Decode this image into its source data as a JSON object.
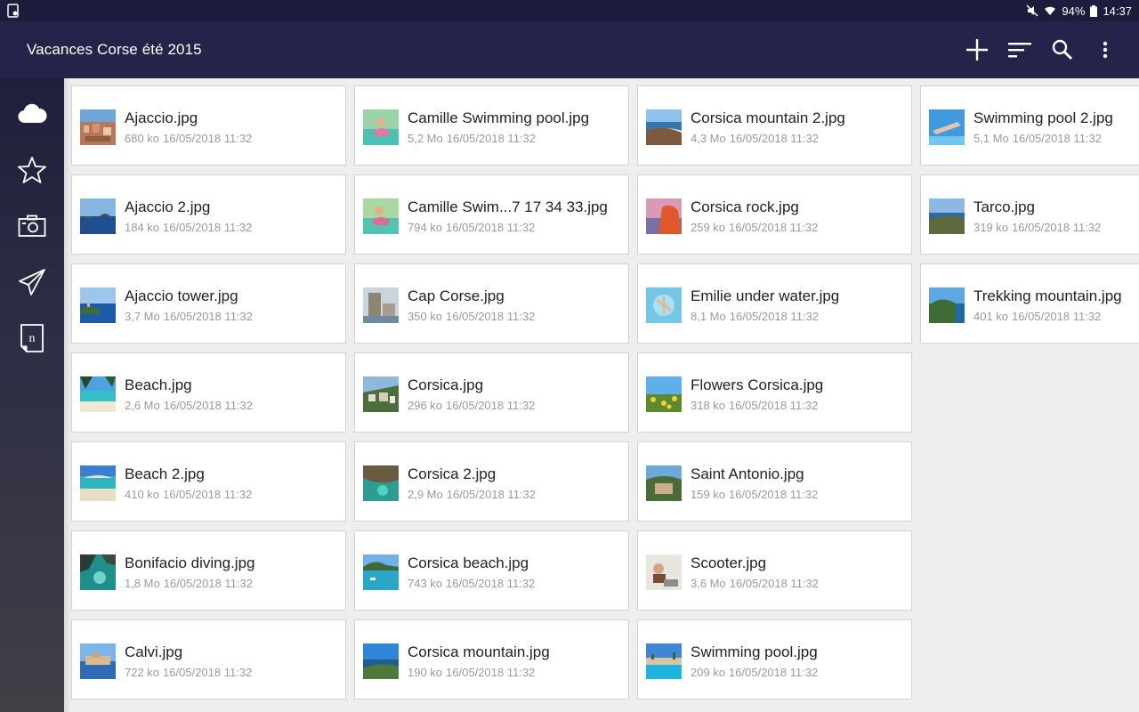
{
  "status_bar": {
    "battery": "94%",
    "time": "14:37"
  },
  "header": {
    "title": "Vacances Corse été 2015",
    "colors": {
      "app_bar": "#24244a",
      "status_bar": "#1c1c3c"
    }
  },
  "rail": {
    "items": [
      {
        "icon": "cloud-icon"
      },
      {
        "icon": "star-icon"
      },
      {
        "icon": "camera-icon"
      },
      {
        "icon": "paper-plane-icon"
      },
      {
        "icon": "note-icon",
        "glyph": "n"
      }
    ]
  },
  "files": [
    {
      "name": "Ajaccio.jpg",
      "size": "680 ko",
      "date": "16/05/2018 11:32"
    },
    {
      "name": "Ajaccio 2.jpg",
      "size": "184 ko",
      "date": "16/05/2018 11:32"
    },
    {
      "name": "Ajaccio tower.jpg",
      "size": "3,7 Mo",
      "date": "16/05/2018 11:32"
    },
    {
      "name": "Beach.jpg",
      "size": "2,6 Mo",
      "date": "16/05/2018 11:32"
    },
    {
      "name": "Beach 2.jpg",
      "size": "410 ko",
      "date": "16/05/2018 11:32"
    },
    {
      "name": "Bonifacio diving.jpg",
      "size": "1,8 Mo",
      "date": "16/05/2018 11:32"
    },
    {
      "name": "Calvi.jpg",
      "size": "722 ko",
      "date": "16/05/2018 11:32"
    },
    {
      "name": "Camille Swimming pool.jpg",
      "size": "5,2 Mo",
      "date": "16/05/2018 11:32"
    },
    {
      "name": "Camille Swim...7 17 34 33.jpg",
      "size": "794 ko",
      "date": "16/05/2018 11:32"
    },
    {
      "name": "Cap Corse.jpg",
      "size": "350 ko",
      "date": "16/05/2018 11:32"
    },
    {
      "name": "Corsica.jpg",
      "size": "296 ko",
      "date": "16/05/2018 11:32"
    },
    {
      "name": "Corsica 2.jpg",
      "size": "2,9 Mo",
      "date": "16/05/2018 11:32"
    },
    {
      "name": "Corsica beach.jpg",
      "size": "743 ko",
      "date": "16/05/2018 11:32"
    },
    {
      "name": "Corsica mountain.jpg",
      "size": "190 ko",
      "date": "16/05/2018 11:32"
    },
    {
      "name": "Corsica mountain 2.jpg",
      "size": "4,3 Mo",
      "date": "16/05/2018 11:32"
    },
    {
      "name": "Corsica rock.jpg",
      "size": "259 ko",
      "date": "16/05/2018 11:32"
    },
    {
      "name": "Emilie under water.jpg",
      "size": "8,1 Mo",
      "date": "16/05/2018 11:32"
    },
    {
      "name": "Flowers Corsica.jpg",
      "size": "318 ko",
      "date": "16/05/2018 11:32"
    },
    {
      "name": "Saint Antonio.jpg",
      "size": "159 ko",
      "date": "16/05/2018 11:32"
    },
    {
      "name": "Scooter.jpg",
      "size": "3,6 Mo",
      "date": "16/05/2018 11:32"
    },
    {
      "name": "Swimming pool.jpg",
      "size": "209 ko",
      "date": "16/05/2018 11:32"
    },
    {
      "name": "Swimming pool 2.jpg",
      "size": "5,1 Mo",
      "date": "16/05/2018 11:32"
    },
    {
      "name": "Tarco.jpg",
      "size": "319 ko",
      "date": "16/05/2018 11:32"
    },
    {
      "name": "Trekking mountain.jpg",
      "size": "401 ko",
      "date": "16/05/2018 11:32"
    }
  ]
}
